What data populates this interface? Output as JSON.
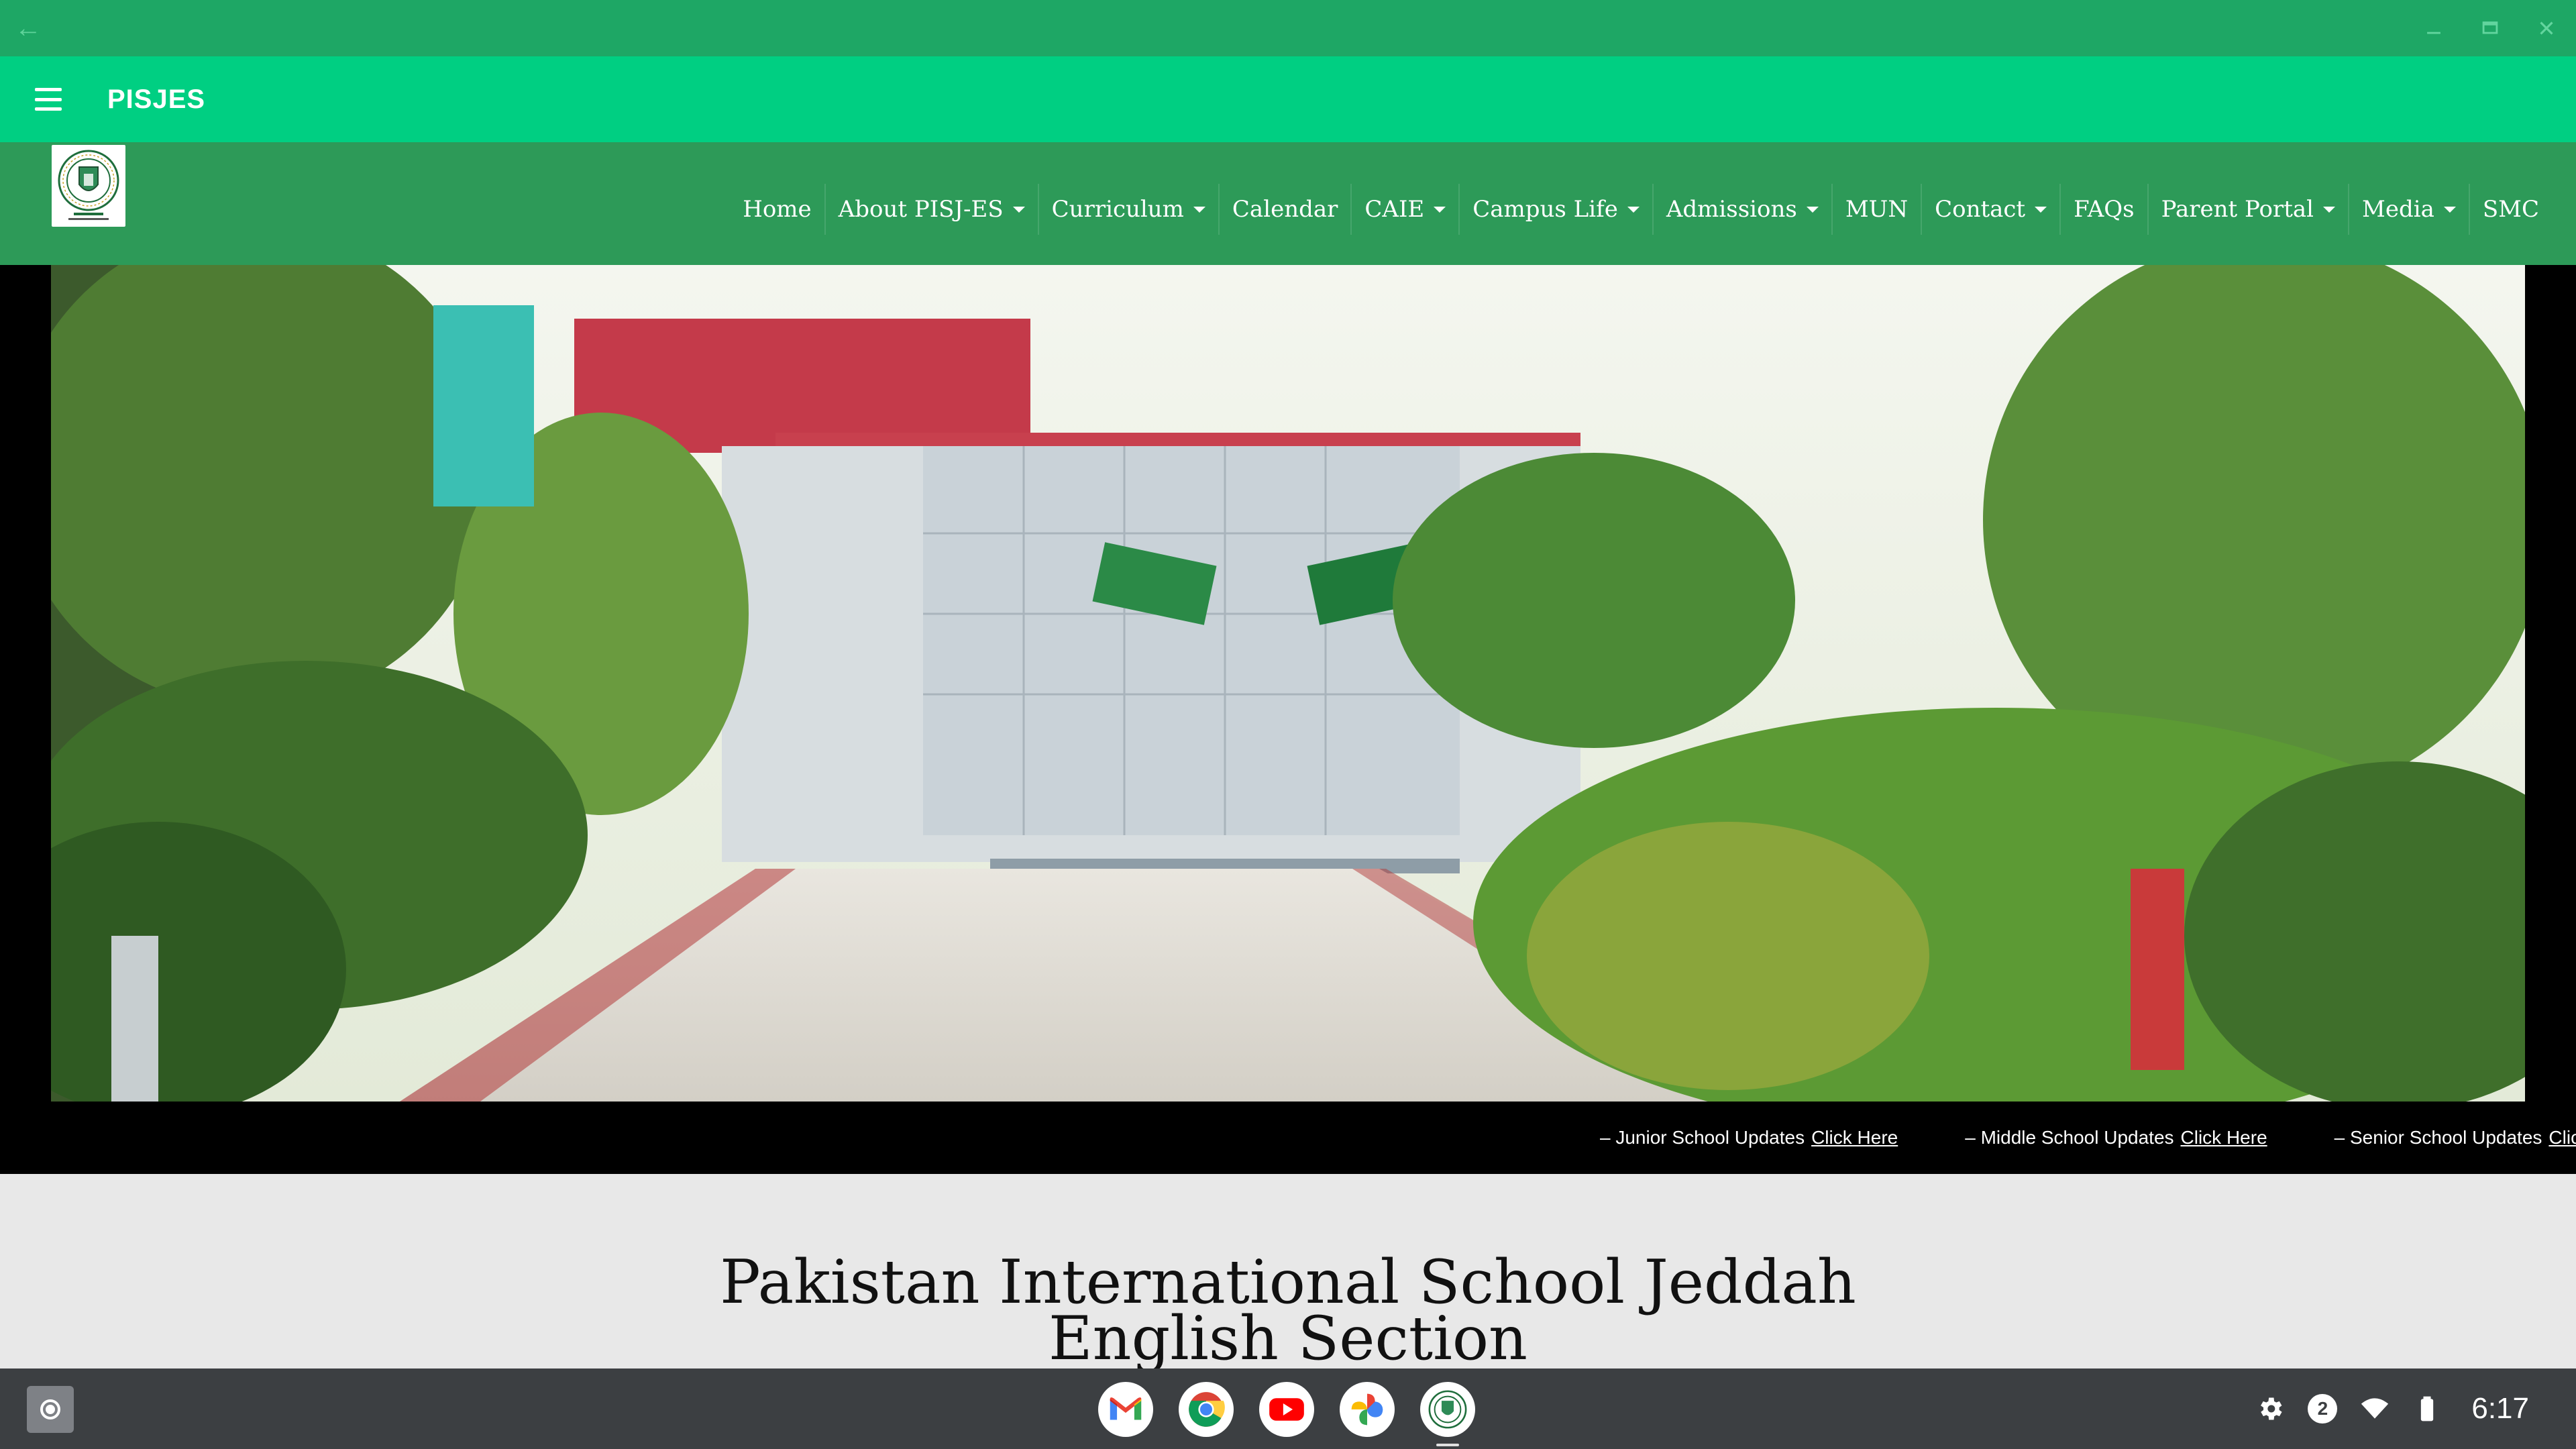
{
  "app_bar": {
    "title": "PISJES"
  },
  "nav": {
    "items": [
      {
        "label": "Home",
        "has_dropdown": false
      },
      {
        "label": "About PISJ-ES",
        "has_dropdown": true
      },
      {
        "label": "Curriculum",
        "has_dropdown": true
      },
      {
        "label": "Calendar",
        "has_dropdown": false
      },
      {
        "label": "CAIE",
        "has_dropdown": true
      },
      {
        "label": "Campus Life",
        "has_dropdown": true
      },
      {
        "label": "Admissions",
        "has_dropdown": true
      },
      {
        "label": "MUN",
        "has_dropdown": false
      },
      {
        "label": "Contact",
        "has_dropdown": true
      },
      {
        "label": "FAQs",
        "has_dropdown": false
      },
      {
        "label": "Parent Portal",
        "has_dropdown": true
      },
      {
        "label": "Media",
        "has_dropdown": true
      },
      {
        "label": "SMC",
        "has_dropdown": false
      }
    ]
  },
  "ticker": {
    "items": [
      {
        "text": "– Junior School Updates",
        "link": "Click Here"
      },
      {
        "text": "– Middle School Updates",
        "link": "Click Here"
      },
      {
        "text": "– Senior School Updates",
        "link": "Click Here"
      }
    ]
  },
  "main": {
    "heading_line1": "Pakistan International School Jeddah",
    "heading_line2": "English Section"
  },
  "shelf": {
    "apps": [
      "gmail-icon",
      "chrome-icon",
      "youtube-icon",
      "photos-icon",
      "pisjes-app-icon"
    ],
    "notification_count": "2",
    "time": "6:17"
  },
  "colors": {
    "title_bar": "#1ea765",
    "app_bar": "#00cf82",
    "site_nav": "#2d9a58",
    "shelf": "#3c3f42"
  }
}
